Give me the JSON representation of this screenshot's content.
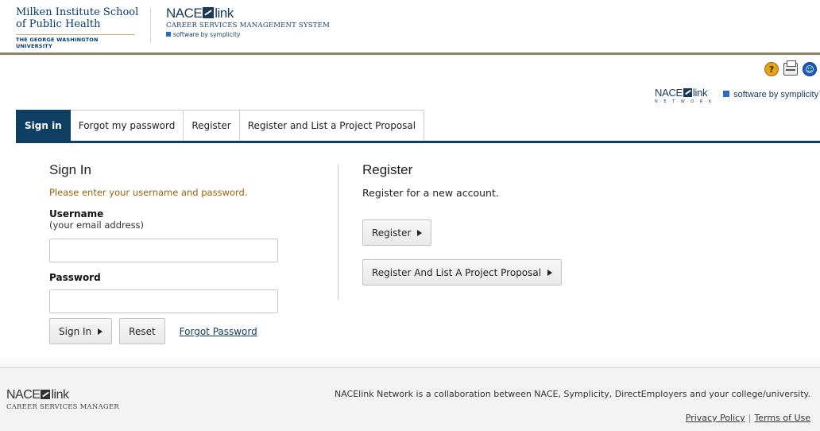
{
  "header": {
    "school_line1": "Milken Institute School",
    "school_line2": "of Public Health",
    "university": "THE GEORGE WASHINGTON UNIVERSITY",
    "nacelink_brand": "NACElink",
    "nacelink_sub": "CAREER SERVICES MANAGEMENT SYSTEM",
    "nacelink_by": "software by symplicity"
  },
  "utility": {
    "help_icon": "help-icon",
    "print_icon": "print-icon",
    "accessibility_icon": "accessibility-icon"
  },
  "network_logo": {
    "brand": "NACElink",
    "sub": "N·E·T·W·O·R·K",
    "by": "software by symplicity™"
  },
  "tabs": [
    {
      "label": "Sign in",
      "active": true
    },
    {
      "label": "Forgot my password",
      "active": false
    },
    {
      "label": "Register",
      "active": false
    },
    {
      "label": "Register and List a Project Proposal",
      "active": false
    }
  ],
  "signin": {
    "title": "Sign In",
    "instruction": "Please enter your username and password.",
    "username_label": "Username",
    "username_hint": "(your email address)",
    "username_value": "",
    "password_label": "Password",
    "password_value": "",
    "signin_button": "Sign In",
    "reset_button": "Reset",
    "forgot_link": "Forgot Password"
  },
  "register": {
    "title": "Register",
    "description": "Register for a new account.",
    "register_button": "Register",
    "register_list_button": "Register And List A Project Proposal"
  },
  "footer": {
    "brand": "NACElink",
    "sub": "CAREER SERVICES MANAGER",
    "collaboration": "NACElink Network is a collaboration between NACE, Symplicity, DirectEmployers and your college/university.",
    "privacy_link": "Privacy Policy",
    "separator": "|",
    "terms_link": "Terms of Use"
  },
  "colors": {
    "primary_navy": "#0e3e62",
    "instruction_orange": "#a0610a",
    "gold_rule": "#8c8468"
  }
}
